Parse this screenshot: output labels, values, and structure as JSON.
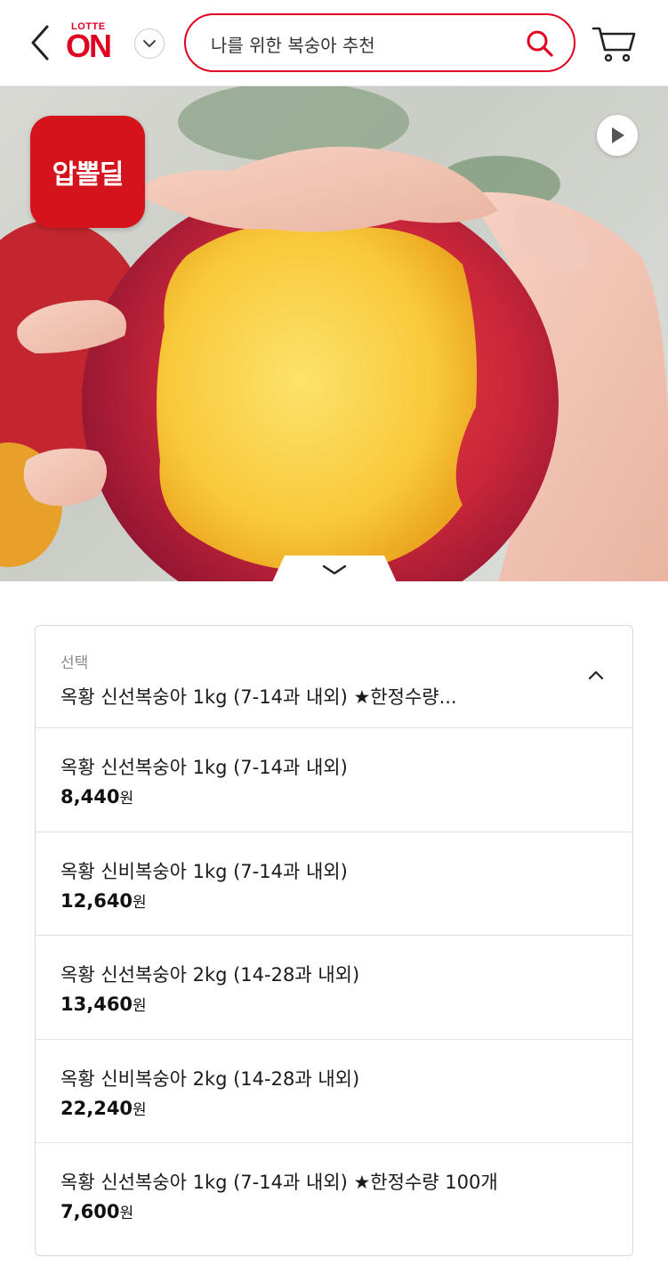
{
  "header": {
    "back_icon": "chevron-left-icon",
    "logo_top": "LOTTE",
    "logo_main": "ON",
    "brand_color": "#e0001f",
    "dropdown_icon": "chevron-down-icon",
    "search_value": "나를 위한 복숭아 추천",
    "search_icon": "search-icon",
    "cart_icon": "cart-icon"
  },
  "hero": {
    "badge_label": "압뽈딜",
    "badge_color": "#d4131c",
    "play_icon": "play-icon",
    "collapse_icon": "chevron-down-icon"
  },
  "option_select": {
    "caption": "선택",
    "selected_value": "옥황 신선복숭아 1kg (7-14과 내외) ★한정수량...",
    "caret_icon": "chevron-up-icon",
    "options": [
      {
        "name": "옥황 신선복숭아 1kg (7-14과 내외)",
        "price": "8,440",
        "unit": "원"
      },
      {
        "name": "옥황 신비복숭아 1kg (7-14과 내외)",
        "price": "12,640",
        "unit": "원"
      },
      {
        "name": "옥황 신선복숭아 2kg (14-28과 내외)",
        "price": "13,460",
        "unit": "원"
      },
      {
        "name": "옥황 신비복숭아 2kg (14-28과 내외)",
        "price": "22,240",
        "unit": "원"
      },
      {
        "name": "옥황 신선복숭아 1kg (7-14과 내외) ★한정수량 100개",
        "price": "7,600",
        "unit": "원"
      }
    ]
  }
}
